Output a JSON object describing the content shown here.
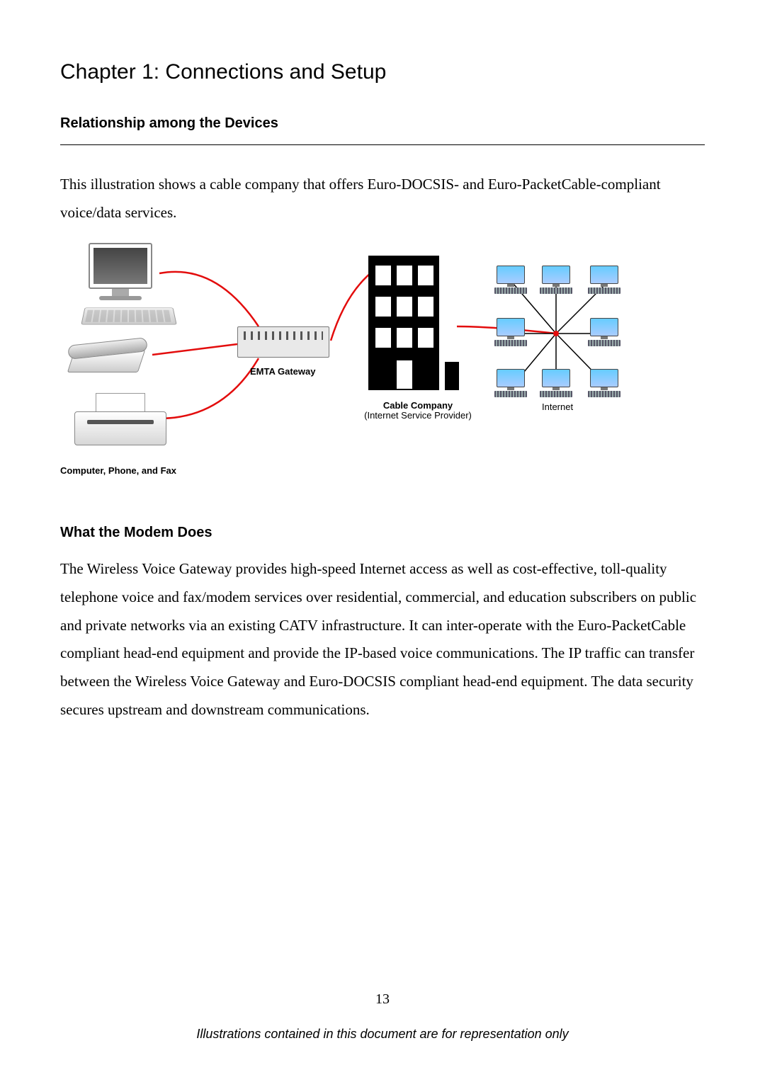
{
  "chapter_title": "Chapter 1: Connections and Setup",
  "section1": {
    "heading": "Relationship among the Devices",
    "intro": "This illustration shows a cable company that offers Euro-DOCSIS- and Euro-PacketCable-compliant voice/data services."
  },
  "diagram": {
    "left_caption": "Computer, Phone, and Fax",
    "emta_label": "EMTA Gateway",
    "building_line1": "Cable Company",
    "building_line2": "(Internet Service Provider)",
    "inet_label": "Internet"
  },
  "section2": {
    "heading": "What the Modem Does",
    "body": "The Wireless Voice Gateway provides high-speed Internet access as well as cost-effective, toll-quality telephone voice and fax/modem services over residential, commercial, and education subscribers on public and private networks via an existing CATV infrastructure. It can inter-operate with the Euro-PacketCable compliant head-end equipment and provide the IP-based voice communications. The IP traffic can transfer between the Wireless Voice Gateway and Euro-DOCSIS compliant head-end equipment. The data security secures upstream and downstream communications."
  },
  "page_number": "13",
  "footer": "Illustrations contained in this document are for representation only"
}
